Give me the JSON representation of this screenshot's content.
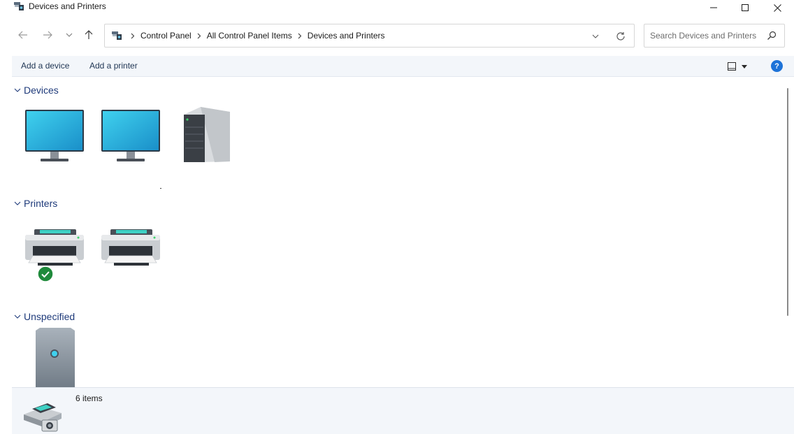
{
  "window": {
    "title": "Devices and Printers"
  },
  "navigation": {
    "breadcrumbs": [
      "Control Panel",
      "All Control Panel Items",
      "Devices and Printers"
    ],
    "search_placeholder": "Search Devices and Printers"
  },
  "commands": {
    "add_device": "Add a device",
    "add_printer": "Add a printer",
    "help": "?"
  },
  "groups": {
    "devices": {
      "title": "Devices",
      "items": [
        {
          "icon": "monitor-icon"
        },
        {
          "icon": "monitor-icon"
        },
        {
          "icon": "computer-tower-icon"
        }
      ]
    },
    "printers": {
      "title": "Printers",
      "items": [
        {
          "icon": "printer-icon",
          "default": true
        },
        {
          "icon": "printer-icon",
          "default": false
        }
      ]
    },
    "unspecified": {
      "title": "Unspecified",
      "items": [
        {
          "icon": "generic-device-icon"
        }
      ]
    }
  },
  "status": {
    "item_count": "6 items"
  },
  "colors": {
    "accent": "#1e73d8",
    "group_title": "#1e3a7a",
    "command_bar_bg": "#f3f6fa",
    "default_badge": "#1f8a3b"
  }
}
